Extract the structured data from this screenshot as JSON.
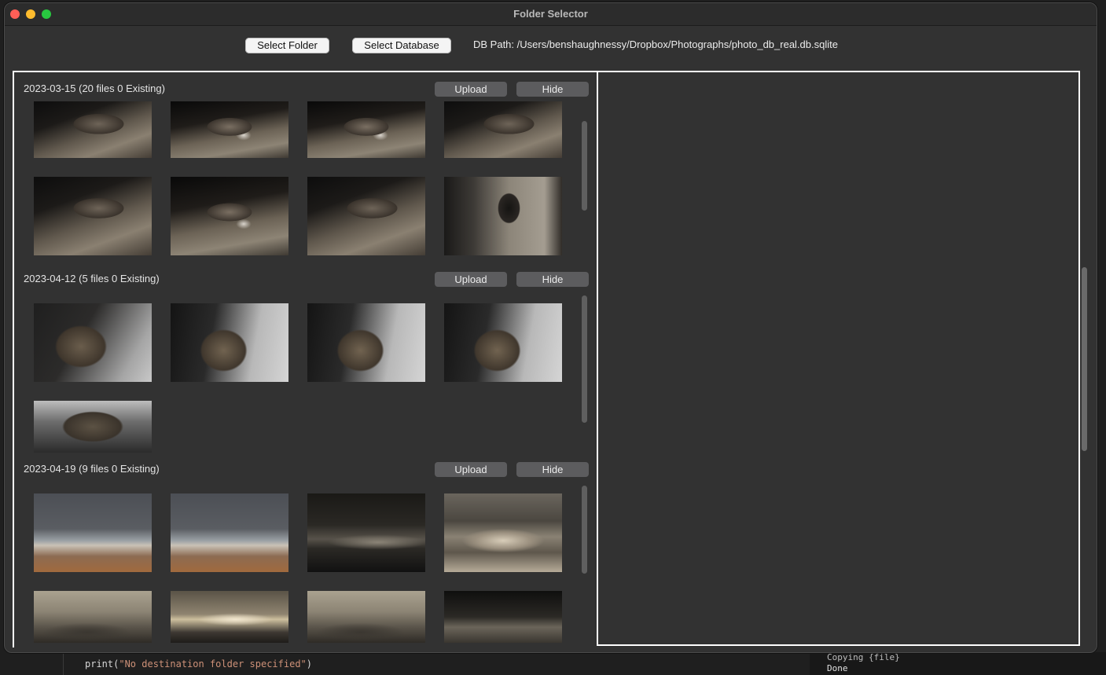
{
  "window": {
    "title": "Folder Selector"
  },
  "toolbar": {
    "select_folder_label": "Select Folder",
    "select_database_label": "Select Database",
    "db_path_text": "DB Path: /Users/benshaughnessy/Dropbox/Photographs/photo_db_real.db.sqlite"
  },
  "groups": [
    {
      "header": "2023-03-15 (20 files 0 Existing)",
      "upload_label": "Upload",
      "hide_label": "Hide"
    },
    {
      "header": "2023-04-12 (5 files 0 Existing)",
      "upload_label": "Upload",
      "hide_label": "Hide"
    },
    {
      "header": "2023-04-19 (9 files 0 Existing)",
      "upload_label": "Upload",
      "hide_label": "Hide"
    }
  ],
  "background": {
    "editor_code_prefix": "print(",
    "editor_code_string": "\"No destination folder specified\"",
    "editor_code_suffix": ")",
    "terminal_line1": "Copying {file}",
    "terminal_line2": "Done"
  },
  "colors": {
    "window_bg": "#323232",
    "button_secondary": "#5c5c5e",
    "panel_border": "#ffffff",
    "close": "#fe5f57",
    "minimize": "#febc2e",
    "maximize": "#28c840"
  }
}
